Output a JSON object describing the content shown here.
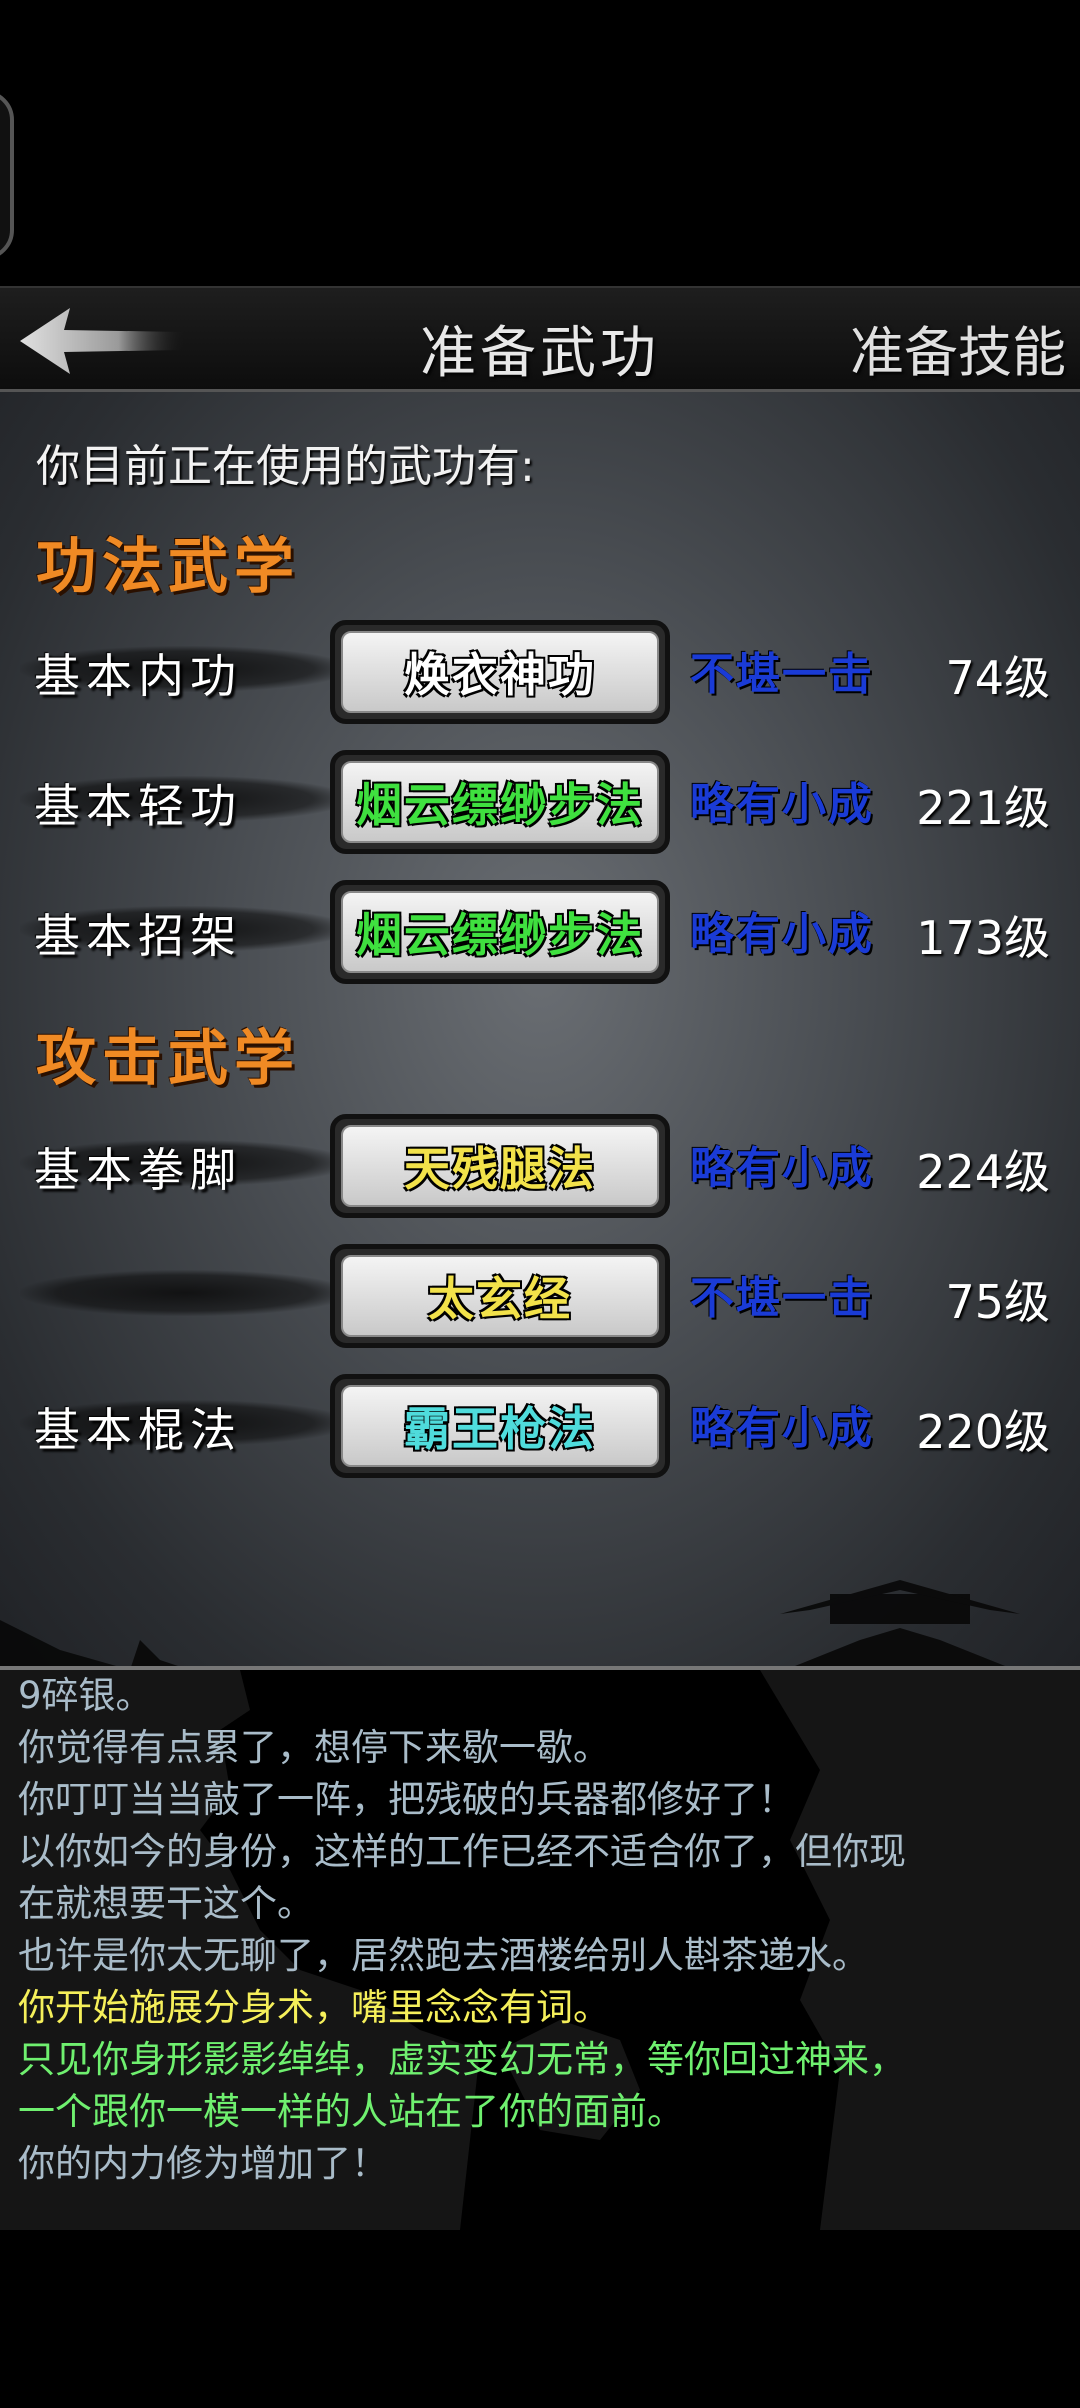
{
  "header": {
    "title": "准备武功",
    "right_label": "准备技能"
  },
  "intro": "你目前正在使用的武功有:",
  "sections": [
    {
      "title": "功法武学",
      "rows": [
        {
          "label": "基本内功",
          "skill": "焕衣神功",
          "skill_color": "#ffffff",
          "level": "不堪一击",
          "rank": "74级"
        },
        {
          "label": "基本轻功",
          "skill": "烟云缥缈步法",
          "skill_color": "#3fe03f",
          "level": "略有小成",
          "rank": "221级"
        },
        {
          "label": "基本招架",
          "skill": "烟云缥缈步法",
          "skill_color": "#3fe03f",
          "level": "略有小成",
          "rank": "173级"
        }
      ]
    },
    {
      "title": "攻击武学",
      "rows": [
        {
          "label": "基本拳脚",
          "skill": "天残腿法",
          "skill_color": "#f2e24a",
          "level": "略有小成",
          "rank": "224级"
        },
        {
          "label": "",
          "skill": "太玄经",
          "skill_color": "#f2e24a",
          "level": "不堪一击",
          "rank": "75级"
        },
        {
          "label": "基本棍法",
          "skill": "霸王枪法",
          "skill_color": "#4fdcdc",
          "level": "略有小成",
          "rank": "220级"
        }
      ]
    }
  ],
  "log": [
    {
      "text": "9碎银。",
      "color": "#a9bcc9"
    },
    {
      "text": "你觉得有点累了，想停下来歇一歇。",
      "color": "#a9bcc9"
    },
    {
      "text": "你叮叮当当敲了一阵，把残破的兵器都修好了！",
      "color": "#a9bcc9"
    },
    {
      "text": "以你如今的身份，这样的工作已经不适合你了，但你现",
      "color": "#a9bcc9"
    },
    {
      "text": "在就想要干这个。",
      "color": "#a9bcc9"
    },
    {
      "text": "也许是你太无聊了，居然跑去酒楼给别人斟茶递水。",
      "color": "#a9bcc9"
    },
    {
      "text": "你开始施展分身术，嘴里念念有词。",
      "color": "#f5ef5a"
    },
    {
      "text": "只见你身形影影绰绰，虚实变幻无常，等你回过神来，",
      "color": "#6ff06f"
    },
    {
      "text": "一个跟你一模一样的人站在了你的面前。",
      "color": "#6ff06f"
    },
    {
      "text": "你的内力修为增加了！",
      "color": "#a9bcc9"
    }
  ]
}
